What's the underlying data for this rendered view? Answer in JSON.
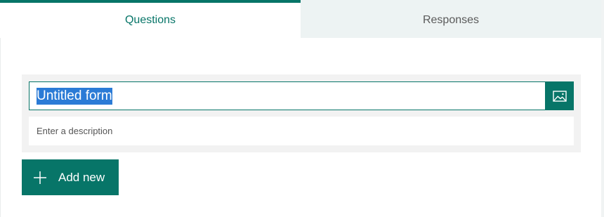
{
  "tabs": {
    "questions": "Questions",
    "responses": "Responses"
  },
  "form": {
    "title_value": "Untitled form",
    "description_placeholder": "Enter a description"
  },
  "actions": {
    "add_new_label": "Add new"
  },
  "icons": {
    "image": "image-icon",
    "plus": "plus-icon"
  },
  "colors": {
    "accent": "#077568",
    "selection": "#2b7bd6",
    "card_background": "#f2f2f2",
    "tab_inactive_background": "#edf3f3"
  }
}
